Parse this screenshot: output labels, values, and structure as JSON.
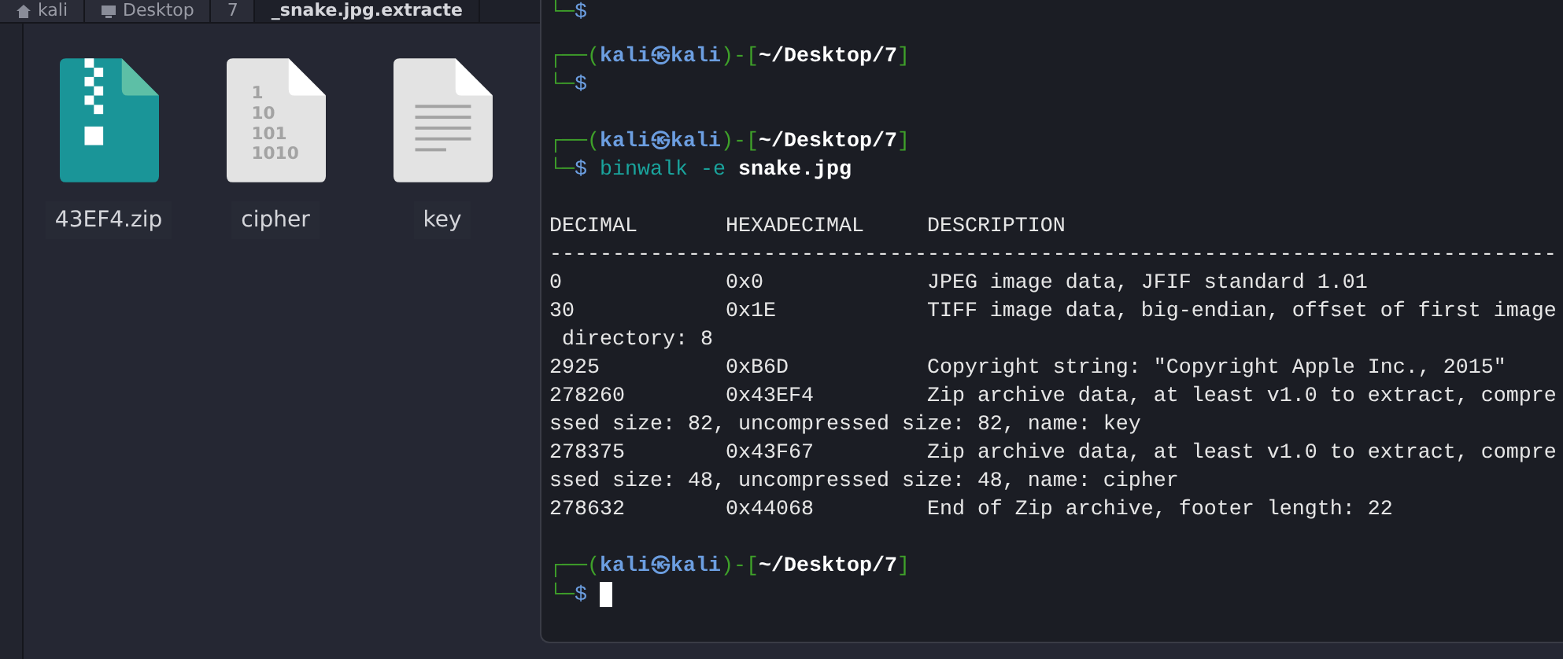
{
  "file_manager": {
    "breadcrumbs": [
      {
        "label": "kali",
        "kind": "home",
        "selected": false
      },
      {
        "label": "Desktop",
        "kind": "desktop",
        "selected": false
      },
      {
        "label": "7",
        "kind": "folder",
        "selected": false
      },
      {
        "label": "_snake.jpg.extracte",
        "kind": "folder",
        "selected": true
      }
    ],
    "files": [
      {
        "name": "43EF4.zip",
        "kind": "archive"
      },
      {
        "name": "cipher",
        "kind": "binary",
        "icon_text": [
          "1",
          "10",
          "101",
          "1010"
        ]
      },
      {
        "name": "key",
        "kind": "text"
      }
    ]
  },
  "terminal": {
    "top_fragment": {
      "corner": "└─",
      "symbol": "$"
    },
    "sessions": [
      {
        "prompt": {
          "open": "┌──(",
          "user": "kali㉿kali",
          "mid": ")-[",
          "path": "~/Desktop/7",
          "close": "]",
          "corner": "└─",
          "symbol": "$"
        },
        "cursor": false
      },
      {
        "prompt": {
          "open": "┌──(",
          "user": "kali㉿kali",
          "mid": ")-[",
          "path": "~/Desktop/7",
          "close": "]",
          "corner": "└─",
          "symbol": "$"
        },
        "command": [
          {
            "text": "binwalk",
            "kind": "program"
          },
          {
            "text": "-e",
            "kind": "option"
          },
          {
            "text": "snake.jpg",
            "kind": "file"
          }
        ],
        "output": {
          "columns": [
            "DECIMAL",
            "HEXADECIMAL",
            "DESCRIPTION"
          ],
          "rule": "--------------------------------------------------------------------------------",
          "rows": [
            {
              "decimal": "0",
              "hex": "0x0",
              "description": "JPEG image data, JFIF standard 1.01"
            },
            {
              "decimal": "30",
              "hex": "0x1E",
              "description": "TIFF image data, big-endian, offset of first image directory: 8"
            },
            {
              "decimal": "2925",
              "hex": "0xB6D",
              "description": "Copyright string: \"Copyright Apple Inc., 2015\""
            },
            {
              "decimal": "278260",
              "hex": "0x43EF4",
              "description": "Zip archive data, at least v1.0 to extract, compressed size: 82, uncompressed size: 82, name: key"
            },
            {
              "decimal": "278375",
              "hex": "0x43F67",
              "description": "Zip archive data, at least v1.0 to extract, compressed size: 48, uncompressed size: 48, name: cipher"
            },
            {
              "decimal": "278632",
              "hex": "0x44068",
              "description": "End of Zip archive, footer length: 22"
            }
          ]
        },
        "cursor": false
      },
      {
        "prompt": {
          "open": "┌──(",
          "user": "kali㉿kali",
          "mid": ")-[",
          "path": "~/Desktop/7",
          "close": "]",
          "corner": "└─",
          "symbol": "$"
        },
        "cursor": true
      }
    ]
  }
}
